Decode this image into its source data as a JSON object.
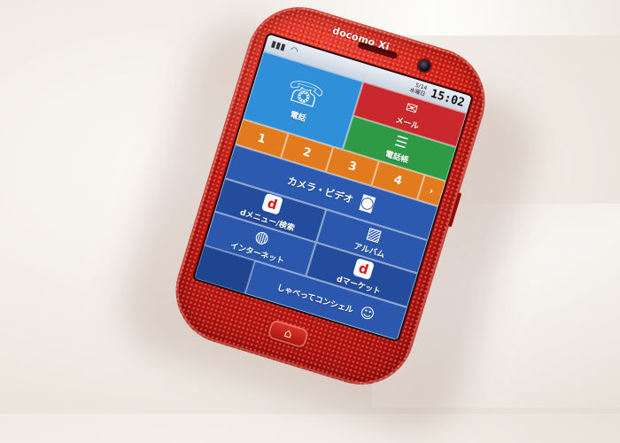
{
  "phone": {
    "brand": "docomo Xi",
    "status": {
      "date": "5/14",
      "weekday": "水曜日",
      "time": "15:02",
      "signal_icon": "signal-bars-icon",
      "wifi_icon": "wifi-icon",
      "battery_icon": "battery-icon"
    },
    "tiles": {
      "phone": {
        "label": "電話",
        "icon": "telephone-icon"
      },
      "mail": {
        "label": "メール",
        "icon": "envelope-icon"
      },
      "contacts": {
        "label": "電話帳",
        "icon": "address-book-icon"
      },
      "speed_dial": [
        "1",
        "2",
        "3",
        "4"
      ],
      "camera": {
        "label": "カメラ・ビデオ",
        "icon": "camera-icon"
      },
      "dmenu": {
        "label": "dメニュー/検索",
        "icon": "d-logo-icon",
        "glyph": "d"
      },
      "album": {
        "label": "アルバム",
        "icon": "photo-icon"
      },
      "internet": {
        "label": "インターネット",
        "icon": "globe-icon"
      },
      "dmarket": {
        "label": "dマーケット",
        "icon": "d-logo-icon",
        "glyph": "d"
      },
      "concier": {
        "label": "しゃべってコンシェル",
        "icon": "concierge-icon"
      }
    }
  },
  "colors": {
    "phone_body": "#d01d15",
    "tile_blue": "#2f8fd8",
    "tile_red": "#c9282c",
    "tile_green": "#2e9a45",
    "tile_orange": "#e27a1e",
    "tile_navy": "#2b57ad"
  }
}
